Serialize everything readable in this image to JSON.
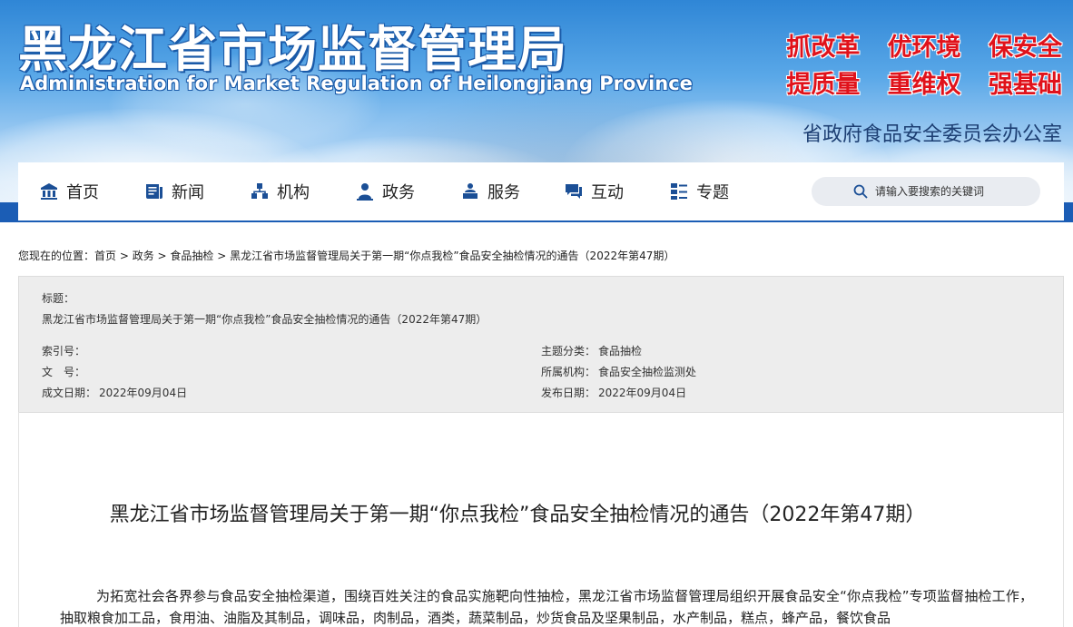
{
  "header": {
    "title": "黑龙江省市场监督管理局",
    "subtitle": "Administration for Market Regulation of Heilongjiang Province",
    "slogans": [
      "抓改革",
      "优环境",
      "保安全",
      "提质量",
      "重维权",
      "强基础"
    ],
    "office": "省政府食品安全委员会办公室"
  },
  "nav": {
    "items": [
      {
        "label": "首页",
        "icon": "home-icon"
      },
      {
        "label": "新闻",
        "icon": "news-icon"
      },
      {
        "label": "机构",
        "icon": "organization-icon"
      },
      {
        "label": "政务",
        "icon": "government-icon"
      },
      {
        "label": "服务",
        "icon": "service-icon"
      },
      {
        "label": "互动",
        "icon": "chat-icon"
      },
      {
        "label": "专题",
        "icon": "topic-icon"
      }
    ],
    "search_placeholder": "请输入要搜索的关键词"
  },
  "breadcrumb": {
    "prefix": "您现在的位置：",
    "items": [
      "首页",
      "政务",
      "食品抽检",
      "黑龙江省市场监督管理局关于第一期“你点我检”食品安全抽检情况的通告（2022年第47期）"
    ],
    "separator": " > "
  },
  "info": {
    "title_label": "标题：",
    "title_value": "黑龙江省市场监督管理局关于第一期“你点我检”食品安全抽检情况的通告（2022年第47期）",
    "index_label": "索引号：",
    "index_value": "",
    "doc_label": "文　号：",
    "doc_value": "",
    "created_label": "成文日期：",
    "created_value": "2022年09月04日",
    "category_label": "主题分类：",
    "category_value": "食品抽检",
    "org_label": "所属机构：",
    "org_value": "食品安全抽检监测处",
    "published_label": "发布日期：",
    "published_value": "2022年09月04日"
  },
  "article": {
    "title": "黑龙江省市场监督管理局关于第一期“你点我检”食品安全抽检情况的通告（2022年第47期）",
    "body": "为拓宽社会各界参与食品安全抽检渠道，围绕百姓关注的食品实施靶向性抽检，黑龙江省市场监督管理局组织开展食品安全“你点我检”专项监督抽检工作，抽取粮食加工品，食用油、油脂及其制品，调味品，肉制品，酒类，蔬菜制品，炒货食品及坚果制品，水产制品，糕点，蜂产品，餐饮食品"
  },
  "colors": {
    "nav_band": "#1b5db5",
    "nav_icon": "#1b4f96",
    "slogan": "#e0121b",
    "office_text": "#1d3f73"
  }
}
